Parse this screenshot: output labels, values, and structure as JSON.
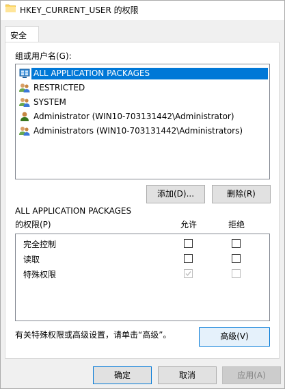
{
  "window": {
    "title": "HKEY_CURRENT_USER 的权限"
  },
  "tabs": [
    {
      "label": "安全"
    }
  ],
  "users_section": {
    "label": "组或用户名(G):",
    "items": [
      {
        "name": "ALL APPLICATION PACKAGES",
        "icon": "group-package-icon",
        "selected": true
      },
      {
        "name": "RESTRICTED",
        "icon": "group-icon",
        "selected": false
      },
      {
        "name": "SYSTEM",
        "icon": "group-icon",
        "selected": false
      },
      {
        "name": "Administrator (WIN10-703131442\\Administrator)",
        "icon": "user-icon",
        "selected": false
      },
      {
        "name": "Administrators (WIN10-703131442\\Administrators)",
        "icon": "group-icon",
        "selected": false
      }
    ],
    "add_label": "添加(D)...",
    "remove_label": "删除(R)"
  },
  "permissions_section": {
    "title_line1": "ALL APPLICATION PACKAGES",
    "title_line2": "的权限(P)",
    "allow_header": "允许",
    "deny_header": "拒绝",
    "rows": [
      {
        "name": "完全控制",
        "allow": false,
        "allow_disabled": false,
        "deny": false,
        "deny_disabled": false
      },
      {
        "name": "读取",
        "allow": false,
        "allow_disabled": false,
        "deny": false,
        "deny_disabled": false
      },
      {
        "name": "特殊权限",
        "allow": true,
        "allow_disabled": true,
        "deny": false,
        "deny_disabled": true
      }
    ]
  },
  "advanced_section": {
    "hint": "有关特殊权限或高级设置，请单击“高级”。",
    "advanced_label": "高级(V)"
  },
  "footer": {
    "ok_label": "确定",
    "cancel_label": "取消",
    "apply_label": "应用(A)"
  },
  "colors": {
    "selection": "#0078d7",
    "dialog_bg": "#f0f0f0",
    "button_bg": "#e1e1e1",
    "disabled_button_bg": "#cccccc"
  }
}
